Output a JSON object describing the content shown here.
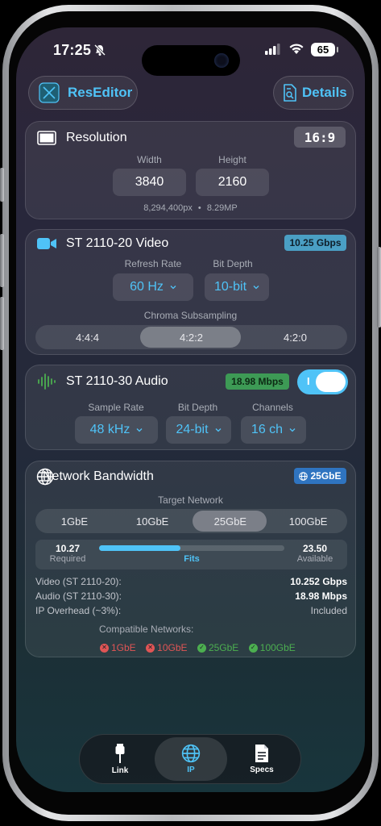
{
  "status": {
    "time": "17:25",
    "battery": "65"
  },
  "header": {
    "app_name": "ResEditor",
    "details_label": "Details"
  },
  "colors": {
    "accent": "#4fc3f7",
    "success": "#4caf50",
    "error": "#e05555",
    "video_badge": "#4a9fc4",
    "audio_badge": "#3d9a55",
    "network_badge": "#2f74c0"
  },
  "resolution": {
    "title": "Resolution",
    "aspect": "16:9",
    "width_label": "Width",
    "height_label": "Height",
    "width": "3840",
    "height": "2160",
    "pixels": "8,294,400px",
    "separator": "•",
    "megapixels": "8.29MP"
  },
  "video": {
    "title": "ST 2110-20 Video",
    "badge": "10.25 Gbps",
    "refresh_label": "Refresh Rate",
    "refresh": "60 Hz",
    "depth_label": "Bit Depth",
    "depth": "10-bit",
    "chroma_label": "Chroma Subsampling",
    "chroma_options": [
      "4:4:4",
      "4:2:2",
      "4:2:0"
    ],
    "chroma_selected": "4:2:2"
  },
  "audio": {
    "title": "ST 2110-30 Audio",
    "badge": "18.98 Mbps",
    "toggle_on": true,
    "toggle_glyph": "I",
    "sample_label": "Sample Rate",
    "sample": "48 kHz",
    "depth_label": "Bit Depth",
    "depth": "24-bit",
    "channels_label": "Channels",
    "channels": "16 ch"
  },
  "network": {
    "title": "Network Bandwidth",
    "badge": "25GbE",
    "target_label": "Target Network",
    "options": [
      "1GbE",
      "10GbE",
      "25GbE",
      "100GbE"
    ],
    "selected": "25GbE",
    "required_value": "10.27",
    "required_label": "Required",
    "available_value": "23.50",
    "available_label": "Available",
    "fits_label": "Fits",
    "usage_fraction": 0.437,
    "breakdown": [
      {
        "label": "Video (ST 2110-20):",
        "value": "10.252 Gbps",
        "bold": true
      },
      {
        "label": "Audio (ST 2110-30):",
        "value": "18.98 Mbps",
        "bold": true
      },
      {
        "label": "IP Overhead (~3%):",
        "value": "Included",
        "bold": false
      }
    ],
    "compat_label": "Compatible Networks:",
    "compat": [
      {
        "name": "1GbE",
        "ok": false
      },
      {
        "name": "10GbE",
        "ok": false
      },
      {
        "name": "25GbE",
        "ok": true
      },
      {
        "name": "100GbE",
        "ok": true
      }
    ]
  },
  "tabs": [
    {
      "label": "Link",
      "icon": "cable-icon",
      "selected": false
    },
    {
      "label": "IP",
      "icon": "globe-icon",
      "selected": true
    },
    {
      "label": "Specs",
      "icon": "document-icon",
      "selected": false
    }
  ]
}
